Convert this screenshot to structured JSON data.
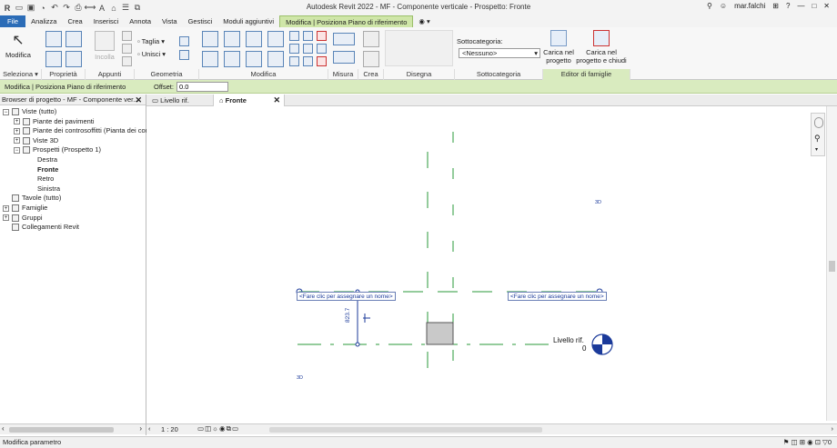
{
  "app": {
    "title": "Autodesk Revit 2022 - MF - Componente verticale - Prospetto: Fronte",
    "user": "mar.falchi"
  },
  "ribbon_tabs": [
    "File",
    "Analizza",
    "Crea",
    "Inserisci",
    "Annota",
    "Vista",
    "Gestisci",
    "Moduli aggiuntivi",
    "Modifica | Posiziona Piano di riferimento"
  ],
  "ribbon": {
    "modifica_label": "Modifica",
    "incolla_label": "Incolla",
    "taglia_label": "Taglia",
    "unisci_label": "Unisci",
    "sottocategoria_label": "Sottocategoria:",
    "sottocategoria_value": "<Nessuno>",
    "carica_progetto_label": "Carica nel progetto",
    "carica_chiudi_label": "Carica nel progetto e chiudi",
    "panels": [
      "Seleziona ▾",
      "Proprietà",
      "Appunti",
      "Geometria",
      "Modifica",
      "Misura",
      "Crea",
      "Disegna",
      "Sottocategoria",
      "Editor di famiglie"
    ]
  },
  "options_bar": {
    "context": "Modifica | Posiziona Piano di riferimento",
    "offset_label": "Offset:",
    "offset_value": "0.0"
  },
  "project_browser": {
    "title": "Browser di progetto - MF - Componente ver...",
    "items": [
      {
        "label": "Viste (tutto)",
        "level": 0,
        "exp": "−"
      },
      {
        "label": "Piante dei pavimenti",
        "level": 1,
        "exp": "+"
      },
      {
        "label": "Piante dei controsoffitti (Pianta dei contr",
        "level": 1,
        "exp": "+"
      },
      {
        "label": "Viste 3D",
        "level": 1,
        "exp": "+"
      },
      {
        "label": "Prospetti (Prospetto 1)",
        "level": 1,
        "exp": "−"
      },
      {
        "label": "Destra",
        "level": 2,
        "exp": ""
      },
      {
        "label": "Fronte",
        "level": 2,
        "exp": "",
        "bold": true
      },
      {
        "label": "Retro",
        "level": 2,
        "exp": ""
      },
      {
        "label": "Sinistra",
        "level": 2,
        "exp": ""
      },
      {
        "label": "Tavole (tutto)",
        "level": 0,
        "exp": ""
      },
      {
        "label": "Famiglie",
        "level": 0,
        "exp": "+"
      },
      {
        "label": "Gruppi",
        "level": 0,
        "exp": "+"
      },
      {
        "label": "Collegamenti Revit",
        "level": 0,
        "exp": ""
      }
    ]
  },
  "view_tabs": [
    {
      "label": "Livello rif.",
      "active": false
    },
    {
      "label": "Fronte",
      "active": true
    }
  ],
  "canvas": {
    "ref_plane_name_left": "<Fare clic per assegnare un nome>",
    "ref_plane_name_right": "<Fare clic per assegnare un nome>",
    "dimension_value": "823.7",
    "level_name": "Livello rif.",
    "level_value": "0",
    "tag_3d": "3D",
    "line_color": "#2a9a3a",
    "annot_color": "#1b3a9a"
  },
  "view_status": {
    "scale": "1 : 20"
  },
  "status_bar": {
    "text": "Modifica parametro",
    "right_value": "0"
  }
}
